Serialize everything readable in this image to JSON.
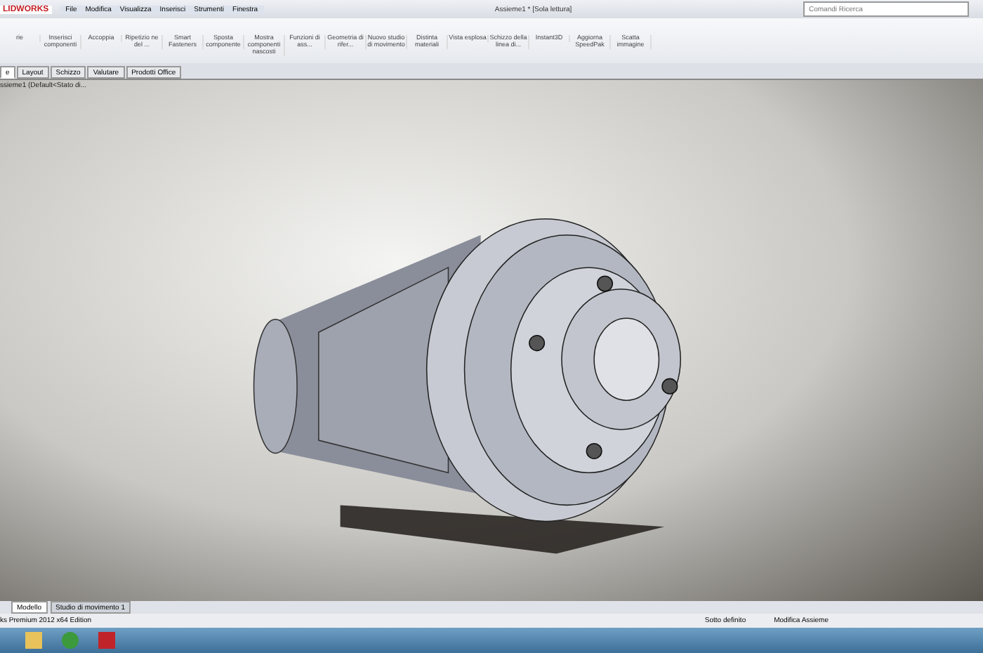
{
  "window": {
    "logo": "LIDWORKS",
    "title": "Assieme1 * [Sola lettura]",
    "search": {
      "placeholder": "Comandi Ricerca"
    }
  },
  "menu": [
    "File",
    "Modifica",
    "Visualizza",
    "Inserisci",
    "Strumenti",
    "Finestra"
  ],
  "toolbar": [
    "rie",
    "Inserisci componenti",
    "Accoppia",
    "Ripetizio ne del ...",
    "Smart Fasteners",
    "Sposta componente",
    "Mostra componenti nascosti",
    "Funzioni di ass...",
    "Geometria di rifer...",
    "Nuovo studio di movimento",
    "Distinta materiali",
    "Vista esplosa",
    "Schizzo della linea di...",
    "Instant3D",
    "Aggiorna SpeedPak",
    "Scatta immagine"
  ],
  "tabs": [
    {
      "label": "e",
      "selected": true
    },
    {
      "label": "Layout",
      "selected": false
    },
    {
      "label": "Schizzo",
      "selected": false
    },
    {
      "label": "Valutare",
      "selected": false
    },
    {
      "label": "Prodotti Office",
      "selected": false
    }
  ],
  "tree": "ssieme1 (Default<Stato di...",
  "bottom_tabs": [
    {
      "label": "Modello",
      "selected": true
    },
    {
      "label": "Studio di movimento 1",
      "selected": false
    }
  ],
  "status_bar": {
    "edition": "ks Premium 2012 x64 Edition",
    "state": "Sotto definito",
    "mode": "Modifica Assieme"
  }
}
